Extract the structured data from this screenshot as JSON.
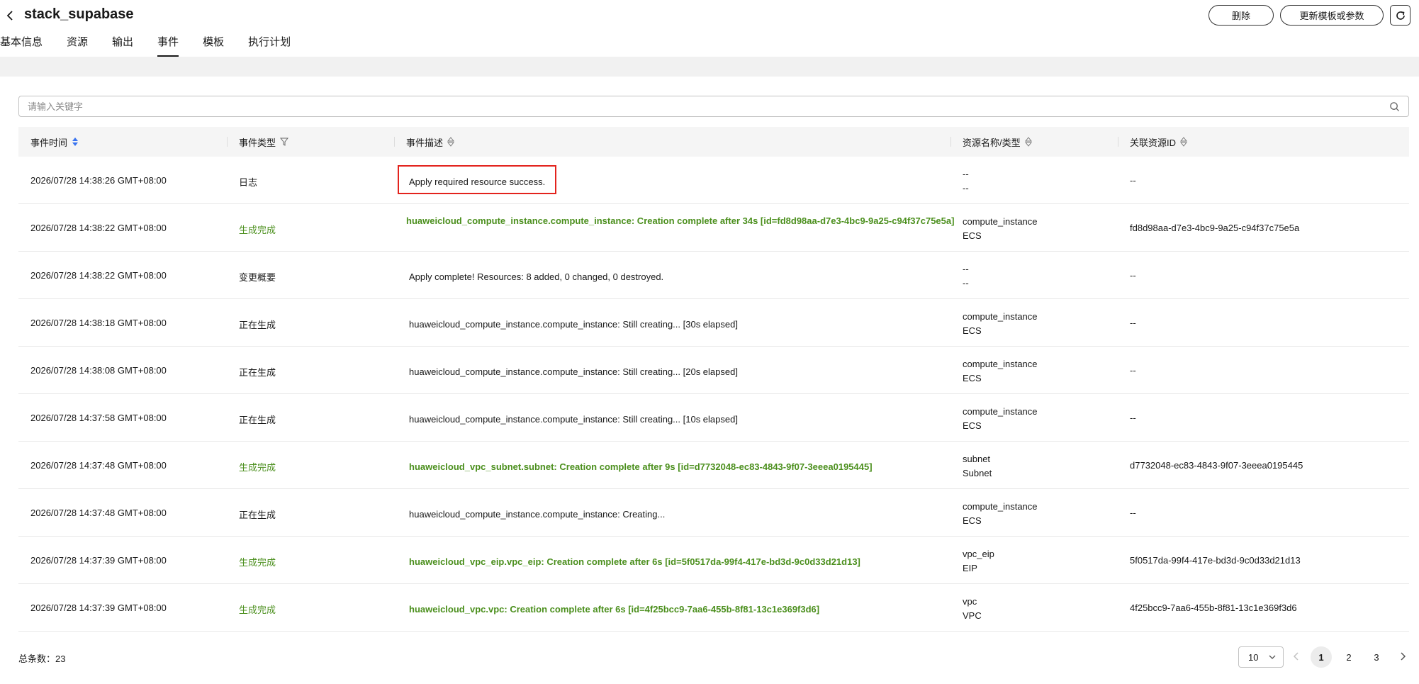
{
  "header": {
    "title": "stack_supabase",
    "delete_label": "删除",
    "update_label": "更新模板或参数"
  },
  "tabs": [
    {
      "label": "基本信息"
    },
    {
      "label": "资源"
    },
    {
      "label": "输出"
    },
    {
      "label": "事件",
      "active": true
    },
    {
      "label": "模板"
    },
    {
      "label": "执行计划"
    }
  ],
  "search": {
    "placeholder": "请输入关键字"
  },
  "table": {
    "headers": {
      "time": "事件时间",
      "type": "事件类型",
      "desc": "事件描述",
      "res": "资源名称/类型",
      "rid": "关联资源ID"
    },
    "rows": [
      {
        "time": "2026/07/28 14:38:26 GMT+08:00",
        "type": "日志",
        "desc": "Apply required resource success.",
        "res_name": "--",
        "res_type": "--",
        "rid": "--"
      },
      {
        "time": "2026/07/28 14:38:22 GMT+08:00",
        "type": "生成完成",
        "desc": "huaweicloud_compute_instance.compute_instance: Creation complete after 34s [id=fd8d98aa-d7e3-4bc9-9a25-c94f37c75e5a]",
        "res_name": "compute_instance",
        "res_type": "ECS",
        "rid": "fd8d98aa-d7e3-4bc9-9a25-c94f37c75e5a"
      },
      {
        "time": "2026/07/28 14:38:22 GMT+08:00",
        "type": "变更概要",
        "desc": "Apply complete! Resources: 8 added, 0 changed, 0 destroyed.",
        "res_name": "--",
        "res_type": "--",
        "rid": "--"
      },
      {
        "time": "2026/07/28 14:38:18 GMT+08:00",
        "type": "正在生成",
        "desc": "huaweicloud_compute_instance.compute_instance: Still creating... [30s elapsed]",
        "res_name": "compute_instance",
        "res_type": "ECS",
        "rid": "--"
      },
      {
        "time": "2026/07/28 14:38:08 GMT+08:00",
        "type": "正在生成",
        "desc": "huaweicloud_compute_instance.compute_instance: Still creating... [20s elapsed]",
        "res_name": "compute_instance",
        "res_type": "ECS",
        "rid": "--"
      },
      {
        "time": "2026/07/28 14:37:58 GMT+08:00",
        "type": "正在生成",
        "desc": "huaweicloud_compute_instance.compute_instance: Still creating... [10s elapsed]",
        "res_name": "compute_instance",
        "res_type": "ECS",
        "rid": "--"
      },
      {
        "time": "2026/07/28 14:37:48 GMT+08:00",
        "type": "生成完成",
        "desc": "huaweicloud_vpc_subnet.subnet: Creation complete after 9s [id=d7732048-ec83-4843-9f07-3eeea0195445]",
        "res_name": "subnet",
        "res_type": "Subnet",
        "rid": "d7732048-ec83-4843-9f07-3eeea0195445"
      },
      {
        "time": "2026/07/28 14:37:48 GMT+08:00",
        "type": "正在生成",
        "desc": "huaweicloud_compute_instance.compute_instance: Creating...",
        "res_name": "compute_instance",
        "res_type": "ECS",
        "rid": "--"
      },
      {
        "time": "2026/07/28 14:37:39 GMT+08:00",
        "type": "生成完成",
        "desc": "huaweicloud_vpc_eip.vpc_eip: Creation complete after 6s [id=5f0517da-99f4-417e-bd3d-9c0d33d21d13]",
        "res_name": "vpc_eip",
        "res_type": "EIP",
        "rid": "5f0517da-99f4-417e-bd3d-9c0d33d21d13"
      },
      {
        "time": "2026/07/28 14:37:39 GMT+08:00",
        "type": "生成完成",
        "desc": "huaweicloud_vpc.vpc: Creation complete after 6s [id=4f25bcc9-7aa6-455b-8f81-13c1e369f3d6]",
        "res_name": "vpc",
        "res_type": "VPC",
        "rid": "4f25bcc9-7aa6-455b-8f81-13c1e369f3d6"
      }
    ]
  },
  "footer": {
    "total_label": "总条数：23",
    "page_size": "10",
    "pages": [
      "1",
      "2",
      "3"
    ],
    "current_page": "1"
  },
  "colors": {
    "success_green": "#4b8f1d",
    "highlight_red": "#e3231d",
    "sort_active_blue": "#3a74f0"
  }
}
